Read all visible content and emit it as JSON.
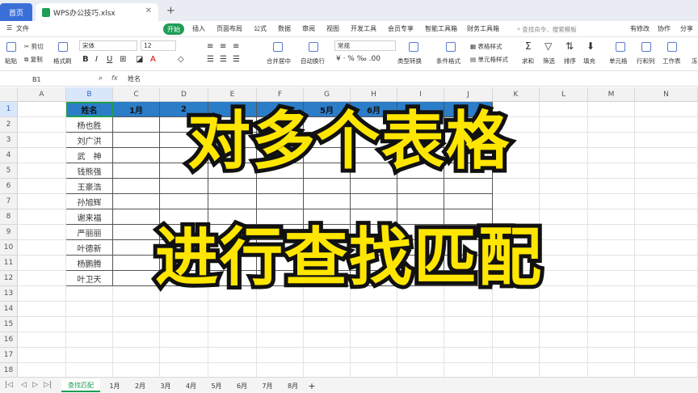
{
  "titlebar": {
    "home_tab": "首页",
    "file_tab": "WPS办公技巧.xlsx",
    "close_glyph": "✕",
    "plus_glyph": "+"
  },
  "menu": {
    "file": "文件",
    "start": "开始",
    "items": [
      "插入",
      "页面布局",
      "公式",
      "数据",
      "审阅",
      "视图",
      "开发工具",
      "会员专享",
      "智能工具箱",
      "财务工具箱"
    ],
    "search_placeholder": "查找命令、搜索模板",
    "right_items": [
      "有修改",
      "协作",
      "分享"
    ]
  },
  "ribbon": {
    "cut": "剪切",
    "paste": "粘贴",
    "copy": "复制",
    "format_painter": "格式刷",
    "font_name": "宋体",
    "font_size": "12",
    "merge_center": "合并居中",
    "wrap_text": "自动换行",
    "number_format": "常规",
    "type_convert": "类型转换",
    "conditional_format": "条件格式",
    "table_style": "表格样式",
    "cell_style": "单元格样式",
    "sum": "求和",
    "filter": "筛选",
    "sort": "排序",
    "fill": "填充",
    "cell": "单元格",
    "row_col": "行和列",
    "worksheet": "工作表",
    "freeze": "冻"
  },
  "formula_bar": {
    "name_box": "B1",
    "fx": "fx",
    "value": "姓名"
  },
  "columns": [
    "A",
    "B",
    "C",
    "D",
    "E",
    "F",
    "G",
    "H",
    "I",
    "J",
    "K",
    "L",
    "M",
    "N"
  ],
  "rows": [
    "1",
    "2",
    "3",
    "4",
    "5",
    "6",
    "7",
    "8",
    "9",
    "10",
    "11",
    "12",
    "13",
    "14",
    "15",
    "16",
    "17",
    "18"
  ],
  "table": {
    "header_name": "姓名",
    "header_c": "1月",
    "header_d": "2",
    "header_g": "5月",
    "header_h": "6月",
    "names": [
      "杨也胜",
      "刘广洪",
      "武　神",
      "钱熊强",
      "王豪浩",
      "孙旭辉",
      "谢来福",
      "严丽丽",
      "叶德新",
      "杨鹏腾",
      "叶卫天"
    ]
  },
  "overlay": {
    "line1": "对多个表格",
    "line2": "进行查找匹配"
  },
  "sheets": {
    "active": "查找匹配",
    "tabs": [
      "1月",
      "2月",
      "3月",
      "4月",
      "5月",
      "6月",
      "7月",
      "8月"
    ],
    "add": "+"
  },
  "colors": {
    "header_fill": "#2b7dc8",
    "overlay_text": "#ffe600",
    "accent": "#1f9d55"
  }
}
